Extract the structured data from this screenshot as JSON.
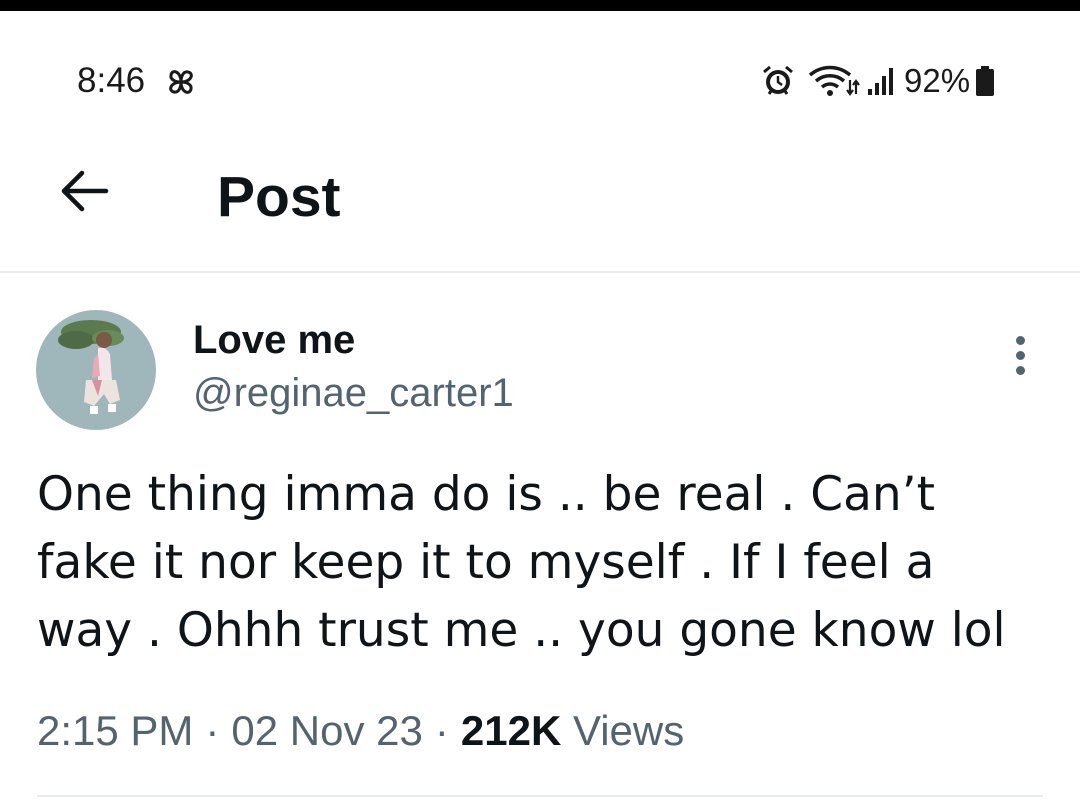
{
  "status_bar": {
    "time": "8:46",
    "battery_percent": "92%",
    "icons": [
      "pinwheel-icon",
      "alarm-icon",
      "wifi-icon",
      "signal-icon",
      "battery-icon"
    ]
  },
  "header": {
    "back_icon": "arrow-left-icon",
    "title": "Post"
  },
  "post": {
    "author_name": "Love me",
    "author_handle": "@reginae_carter1",
    "text_lines": [
      "One thing imma do is .. be real . Can’t",
      "fake it nor keep it to myself . If I feel a",
      "way . Ohhh trust me .. you gone know lol"
    ],
    "time": "2:15 PM",
    "date": "02 Nov 23",
    "views_count": "212K",
    "views_label": "Views",
    "separator": "·",
    "more_icon": "more-vertical-icon"
  },
  "colors": {
    "text_primary": "#0f1419",
    "text_secondary": "#536471",
    "divider": "#e6ecf0",
    "top_bar": "#000000"
  }
}
